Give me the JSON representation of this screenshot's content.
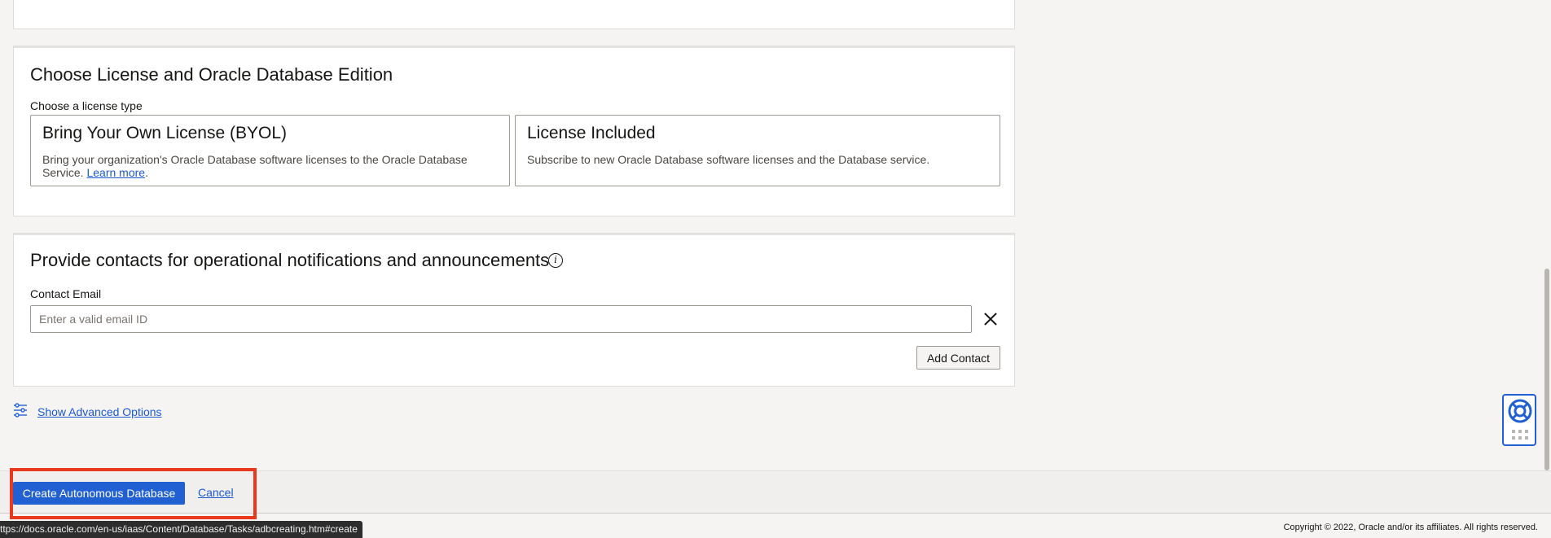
{
  "license_section": {
    "title": "Choose License and Oracle Database Edition",
    "choose_label": "Choose a license type",
    "byol": {
      "title": "Bring Your Own License (BYOL)",
      "desc": "Bring your organization's Oracle Database software licenses to the Oracle Database Service.",
      "learn_more": "Learn more"
    },
    "included": {
      "title": "License Included",
      "desc": "Subscribe to new Oracle Database software licenses and the Database service."
    }
  },
  "contacts_section": {
    "title": "Provide contacts for operational notifications and announcements",
    "email_label": "Contact Email",
    "email_placeholder": "Enter a valid email ID",
    "email_value": "",
    "add_contact": "Add Contact"
  },
  "advanced": {
    "label": "Show Advanced Options"
  },
  "footer": {
    "create_label": "Create Autonomous Database",
    "cancel_label": "Cancel",
    "status_url": "ttps://docs.oracle.com/en-us/iaas/Content/Database/Tasks/adbcreating.htm#create",
    "copyright": "Copyright © 2022, Oracle and/or its affiliates. All rights reserved."
  },
  "colors": {
    "primary": "#2160d3",
    "link": "#1d5ad1",
    "highlight": "#e8391f"
  },
  "icons": [
    "info-icon",
    "close-icon",
    "sliders-icon",
    "lifebuoy-icon",
    "grid-icon"
  ]
}
